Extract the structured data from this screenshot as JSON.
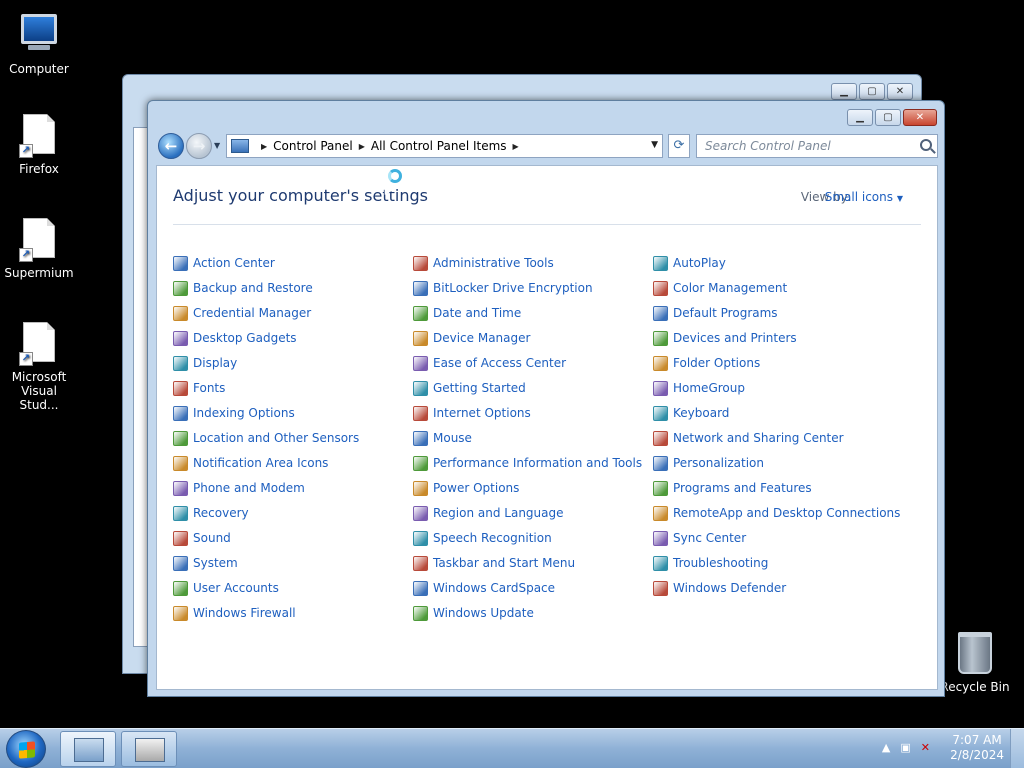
{
  "desktop": {
    "icons": [
      {
        "label": "Computer"
      },
      {
        "label": "Firefox"
      },
      {
        "label": "Supermium"
      },
      {
        "label": "Microsoft Visual Stud..."
      },
      {
        "label": "Recycle Bin"
      }
    ]
  },
  "window": {
    "caption_buttons": {
      "minimize": "▁",
      "maximize": "▢",
      "close": "✕"
    },
    "breadcrumb": [
      "Control Panel",
      "All Control Panel Items"
    ],
    "search_placeholder": "Search Control Panel",
    "title": "Adjust your computer's settings",
    "view_by_label": "View by:",
    "view_by_value": "Small icons"
  },
  "items": [
    [
      "Action Center",
      "Backup and Restore",
      "Credential Manager",
      "Desktop Gadgets",
      "Display",
      "Fonts",
      "Indexing Options",
      "Location and Other Sensors",
      "Notification Area Icons",
      "Phone and Modem",
      "Recovery",
      "Sound",
      "System",
      "User Accounts",
      "Windows Firewall"
    ],
    [
      "Administrative Tools",
      "BitLocker Drive Encryption",
      "Date and Time",
      "Device Manager",
      "Ease of Access Center",
      "Getting Started",
      "Internet Options",
      "Mouse",
      "Performance Information and Tools",
      "Power Options",
      "Region and Language",
      "Speech Recognition",
      "Taskbar and Start Menu",
      "Windows CardSpace",
      "Windows Update"
    ],
    [
      "AutoPlay",
      "Color Management",
      "Default Programs",
      "Devices and Printers",
      "Folder Options",
      "HomeGroup",
      "Keyboard",
      "Network and Sharing Center",
      "Personalization",
      "Programs and Features",
      "RemoteApp and Desktop Connections",
      "Sync Center",
      "Troubleshooting",
      "Windows Defender"
    ]
  ],
  "item_icon_colors": [
    "#3a6fb8",
    "#4e9a3a",
    "#c98a2a",
    "#7a5cb0",
    "#2f8fa8",
    "#b84a3a"
  ],
  "taskbar": {
    "time": "7:07 AM",
    "date": "2/8/2024"
  }
}
